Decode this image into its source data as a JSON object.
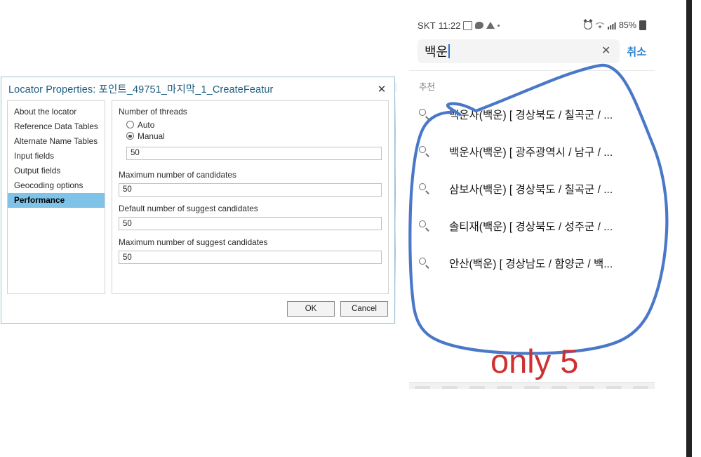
{
  "desktop": {
    "dialog": {
      "title": "Locator Properties: 포인트_49751_마지막_1_CreateFeatur",
      "close_label": "✕",
      "sidebar": {
        "items": [
          {
            "label": "About the locator",
            "selected": false
          },
          {
            "label": "Reference Data Tables",
            "selected": false
          },
          {
            "label": "Alternate Name Tables",
            "selected": false
          },
          {
            "label": "Input fields",
            "selected": false
          },
          {
            "label": "Output fields",
            "selected": false
          },
          {
            "label": "Geocoding options",
            "selected": false
          },
          {
            "label": "Performance",
            "selected": true
          }
        ]
      },
      "performance_panel": {
        "threads_label": "Number of threads",
        "radio_auto": "Auto",
        "radio_manual": "Manual",
        "radio_selected": "Manual",
        "threads_value": "50",
        "max_candidates_label": "Maximum number of candidates",
        "max_candidates_value": "50",
        "default_suggest_label": "Default number of suggest candidates",
        "default_suggest_value": "50",
        "max_suggest_label": "Maximum number of suggest candidates",
        "max_suggest_value": "50"
      },
      "buttons": {
        "ok": "OK",
        "cancel": "Cancel"
      },
      "accent_color": "#1c5d80",
      "selection_color": "#7fc3e8"
    }
  },
  "phone": {
    "status_bar": {
      "carrier": "SKT",
      "time": "11:22",
      "battery_percent": "85%",
      "left_icons": [
        "qr-icon",
        "message-bubble-icon",
        "warning-triangle-icon",
        "dot-icon"
      ],
      "right_icons": [
        "alarm-icon",
        "wifi-icon",
        "signal-bars-icon",
        "battery-icon"
      ]
    },
    "search": {
      "value": "백운",
      "clear_label": "✕",
      "cancel_label": "취소",
      "cancel_color": "#2a7fd0"
    },
    "suggestions": {
      "header": "추천",
      "items": [
        {
          "text": "백운사(백운) [ 경상북도 / 칠곡군 / ..."
        },
        {
          "text": "백운사(백운) [ 광주광역시 / 남구 / ..."
        },
        {
          "text": "삼보사(백운) [ 경상북도 / 칠곡군 / ..."
        },
        {
          "text": "솔티재(백운) [ 경상북도 / 성주군 / ..."
        },
        {
          "text": "안산(백운) [ 경상남도 / 함양군 / 백..."
        }
      ]
    }
  },
  "annotation": {
    "label": "only 5",
    "label_color": "#cf3030",
    "circle_color": "#4a78c8"
  }
}
